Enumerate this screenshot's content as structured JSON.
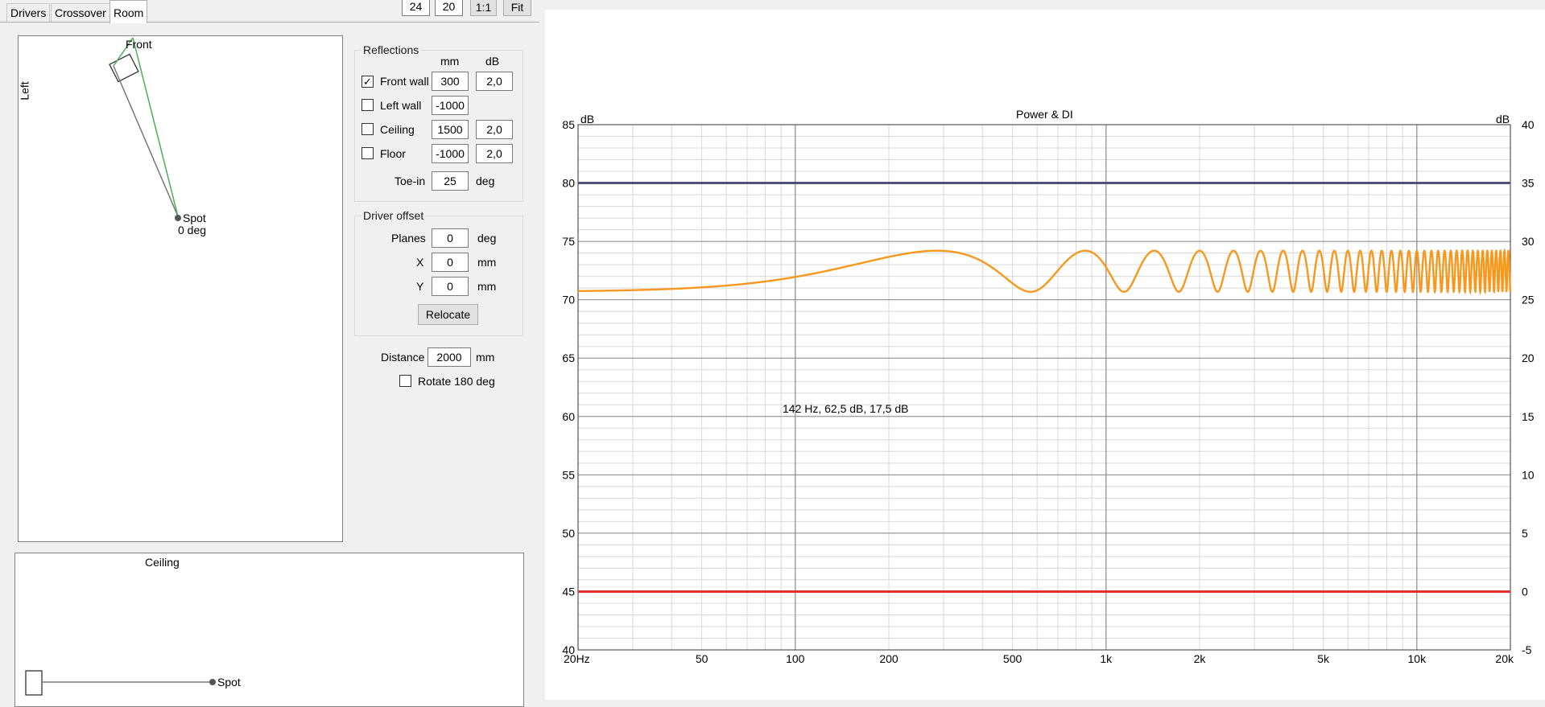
{
  "tabs": [
    {
      "label": "Drivers",
      "active": false
    },
    {
      "label": "Crossover",
      "active": false
    },
    {
      "label": "Room",
      "active": true
    }
  ],
  "toolbar": {
    "width_value": "24",
    "height_value": "20",
    "one_to_one_label": "1:1",
    "fit_label": "Fit"
  },
  "plan_top": {
    "front_label": "Front",
    "left_label": "Left",
    "spot_label": "Spot",
    "spot_angle": "0 deg"
  },
  "plan_side": {
    "ceiling_label": "Ceiling",
    "spot_label": "Spot"
  },
  "reflections": {
    "title": "Reflections",
    "col_mm": "mm",
    "col_db": "dB",
    "rows": [
      {
        "label": "Front wall",
        "checked": true,
        "mm": "300",
        "db": "2,0"
      },
      {
        "label": "Left wall",
        "checked": false,
        "mm": "-1000",
        "db": ""
      },
      {
        "label": "Ceiling",
        "checked": false,
        "mm": "1500",
        "db": "2,0"
      },
      {
        "label": "Floor",
        "checked": false,
        "mm": "-1000",
        "db": "2,0"
      }
    ],
    "toe_in_label": "Toe-in",
    "toe_in_value": "25",
    "toe_in_unit": "deg"
  },
  "driver_offset": {
    "title": "Driver offset",
    "planes_label": "Planes",
    "planes_value": "0",
    "planes_unit": "deg",
    "x_label": "X",
    "x_value": "0",
    "x_unit": "mm",
    "y_label": "Y",
    "y_value": "0",
    "y_unit": "mm",
    "relocate_label": "Relocate"
  },
  "distance": {
    "label": "Distance",
    "value": "2000",
    "unit": "mm"
  },
  "rotate": {
    "label": "Rotate 180 deg",
    "checked": false
  },
  "colors": {
    "response": "#f7981d",
    "power": "#50507a",
    "di": "#e03030",
    "grid_major": "#8c8c8c",
    "grid_minor": "#d8d8d8"
  },
  "chart_data": {
    "type": "line",
    "title": "Power & DI",
    "x_scale": "log",
    "xlim": [
      20,
      20000
    ],
    "x_ticks": [
      {
        "value": 20,
        "label": "20Hz"
      },
      {
        "value": 50,
        "label": "50"
      },
      {
        "value": 100,
        "label": "100"
      },
      {
        "value": 200,
        "label": "200"
      },
      {
        "value": 500,
        "label": "500"
      },
      {
        "value": 1000,
        "label": "1k"
      },
      {
        "value": 2000,
        "label": "2k"
      },
      {
        "value": 5000,
        "label": "5k"
      },
      {
        "value": 10000,
        "label": "10k"
      },
      {
        "value": 20000,
        "label": "20k"
      }
    ],
    "y_left": {
      "label": "dB",
      "lim": [
        40,
        85
      ],
      "ticks": [
        "40",
        "45",
        "50",
        "55",
        "60",
        "65",
        "70",
        "75",
        "80",
        "85"
      ]
    },
    "y_right": {
      "label": "dB",
      "lim": [
        -5,
        40
      ],
      "ticks": [
        "-5",
        "0",
        "5",
        "10",
        "15",
        "20",
        "25",
        "30",
        "35",
        "40"
      ]
    },
    "annotation": "142 Hz, 62,5 dB, 17,5 dB",
    "series": [
      {
        "axis": "left",
        "style": "comb",
        "level_db": 74.2,
        "reflection_gain": 0.2,
        "reflection_delay_ms": 1.75,
        "rolloff_hz": 20000
      },
      {
        "axis": "left",
        "style": "flat",
        "value_db": 80
      },
      {
        "axis": "right",
        "style": "flat",
        "value_db": 0
      }
    ]
  }
}
